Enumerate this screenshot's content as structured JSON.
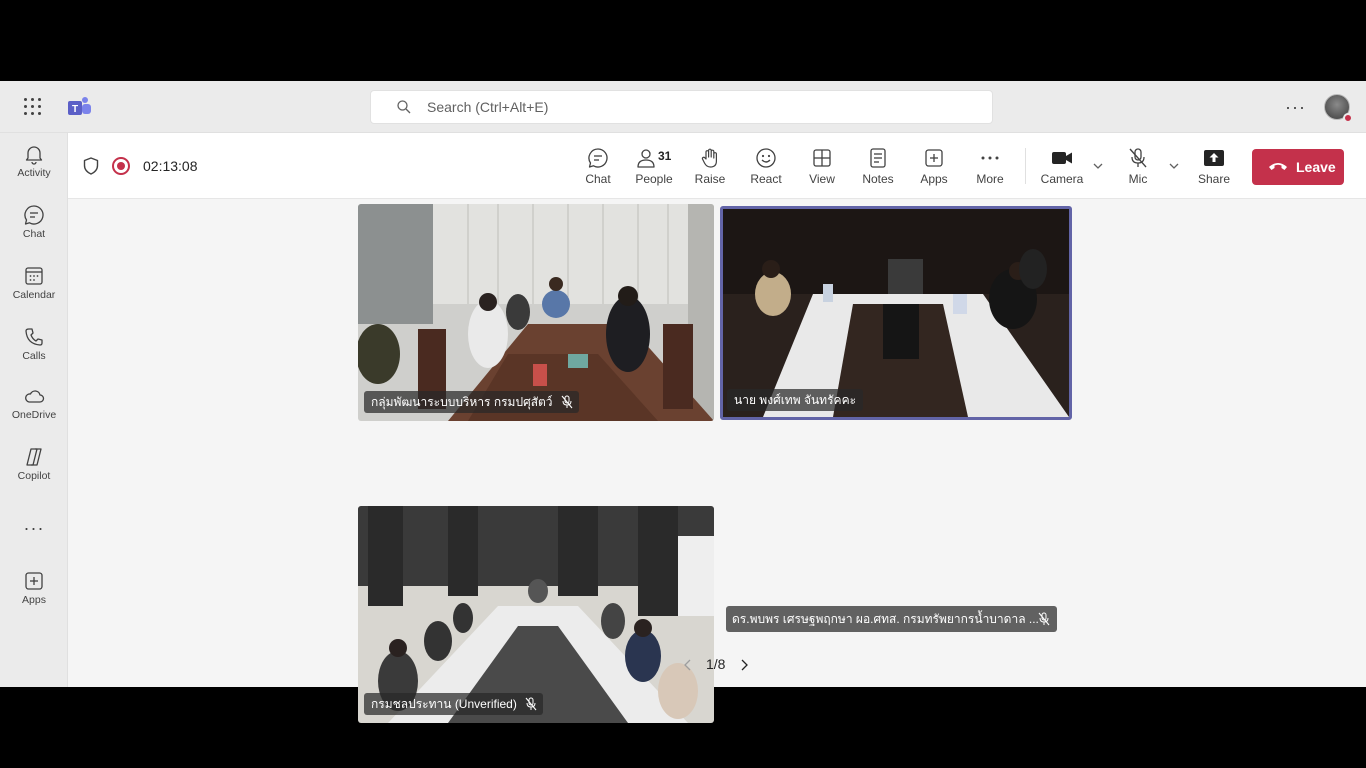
{
  "search": {
    "placeholder": "Search (Ctrl+Alt+E)"
  },
  "rail": {
    "items": [
      {
        "label": "Activity",
        "icon": "bell-icon"
      },
      {
        "label": "Chat",
        "icon": "chat-icon"
      },
      {
        "label": "Calendar",
        "icon": "calendar-icon"
      },
      {
        "label": "Calls",
        "icon": "phone-icon"
      },
      {
        "label": "OneDrive",
        "icon": "cloud-icon"
      },
      {
        "label": "Copilot",
        "icon": "copilot-icon"
      },
      {
        "label": "Apps",
        "icon": "add-app-icon"
      }
    ]
  },
  "meeting": {
    "elapsed": "02:13:08",
    "people_count": "31",
    "toolbar": {
      "chat": "Chat",
      "people": "People",
      "raise": "Raise",
      "react": "React",
      "view": "View",
      "notes": "Notes",
      "apps": "Apps",
      "more": "More",
      "camera": "Camera",
      "mic": "Mic",
      "share": "Share",
      "leave": "Leave"
    }
  },
  "tiles": [
    {
      "name": "กลุ่มพัฒนาระบบบริหาร กรมปศุสัตว์"
    },
    {
      "name": "นาย พงศ์เทพ จันทรัคคะ"
    },
    {
      "name": "กรมชลประทาน (Unverified)"
    },
    {
      "name": "ดร.พบพร เศรษฐพฤกษา ผอ.ศทส. กรมทรัพยากรน้ำบาดาล ..."
    }
  ],
  "pager": {
    "text": "1/8"
  },
  "colors": {
    "accent": "#6264a7",
    "leave": "#c4314b"
  }
}
